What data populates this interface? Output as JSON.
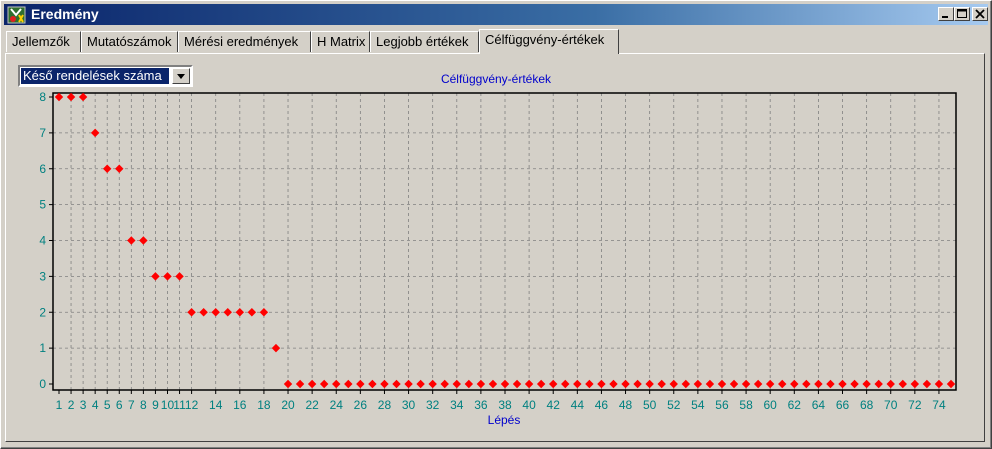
{
  "window": {
    "title": "Eredmény",
    "controls": [
      "minimize-icon",
      "maximize-icon",
      "close-icon"
    ]
  },
  "tabs": [
    {
      "label": "Jellemzők"
    },
    {
      "label": "Mutatószámok"
    },
    {
      "label": "Mérési eredmények"
    },
    {
      "label": "H Matrix"
    },
    {
      "label": "Legjobb értékek"
    },
    {
      "label": "Célfüggvény-értékek"
    }
  ],
  "active_tab": "Célfüggvény-értékek",
  "selector": {
    "selected": "Késő rendelések száma"
  },
  "colors": {
    "marker": "#ff0000",
    "axis_text": "#008080",
    "title_text": "#0000cc",
    "grid": "#808080"
  },
  "chart_data": {
    "type": "scatter",
    "title": "Célfüggvény-értékek",
    "xlabel": "Lépés",
    "ylabel": "",
    "xlim": [
      1,
      75
    ],
    "ylim": [
      0,
      8
    ],
    "grid": true,
    "x_ticks": [
      1,
      2,
      3,
      4,
      5,
      6,
      7,
      8,
      9,
      10,
      11,
      12,
      14,
      16,
      18,
      20,
      22,
      24,
      26,
      28,
      30,
      32,
      34,
      36,
      38,
      40,
      42,
      44,
      46,
      48,
      50,
      52,
      54,
      56,
      58,
      60,
      62,
      64,
      66,
      68,
      70,
      72,
      74
    ],
    "y_ticks": [
      0,
      1,
      2,
      3,
      4,
      5,
      6,
      7,
      8
    ],
    "x": [
      1,
      2,
      3,
      4,
      5,
      6,
      7,
      8,
      9,
      10,
      11,
      12,
      13,
      14,
      15,
      16,
      17,
      18,
      19,
      20,
      21,
      22,
      23,
      24,
      25,
      26,
      27,
      28,
      29,
      30,
      31,
      32,
      33,
      34,
      35,
      36,
      37,
      38,
      39,
      40,
      41,
      42,
      43,
      44,
      45,
      46,
      47,
      48,
      49,
      50,
      51,
      52,
      53,
      54,
      55,
      56,
      57,
      58,
      59,
      60,
      61,
      62,
      63,
      64,
      65,
      66,
      67,
      68,
      69,
      70,
      71,
      72,
      73,
      74,
      75
    ],
    "y": [
      8,
      8,
      8,
      7,
      6,
      6,
      4,
      4,
      3,
      3,
      3,
      2,
      2,
      2,
      2,
      2,
      2,
      2,
      1,
      0,
      0,
      0,
      0,
      0,
      0,
      0,
      0,
      0,
      0,
      0,
      0,
      0,
      0,
      0,
      0,
      0,
      0,
      0,
      0,
      0,
      0,
      0,
      0,
      0,
      0,
      0,
      0,
      0,
      0,
      0,
      0,
      0,
      0,
      0,
      0,
      0,
      0,
      0,
      0,
      0,
      0,
      0,
      0,
      0,
      0,
      0,
      0,
      0,
      0,
      0,
      0,
      0,
      0,
      0,
      0
    ]
  }
}
